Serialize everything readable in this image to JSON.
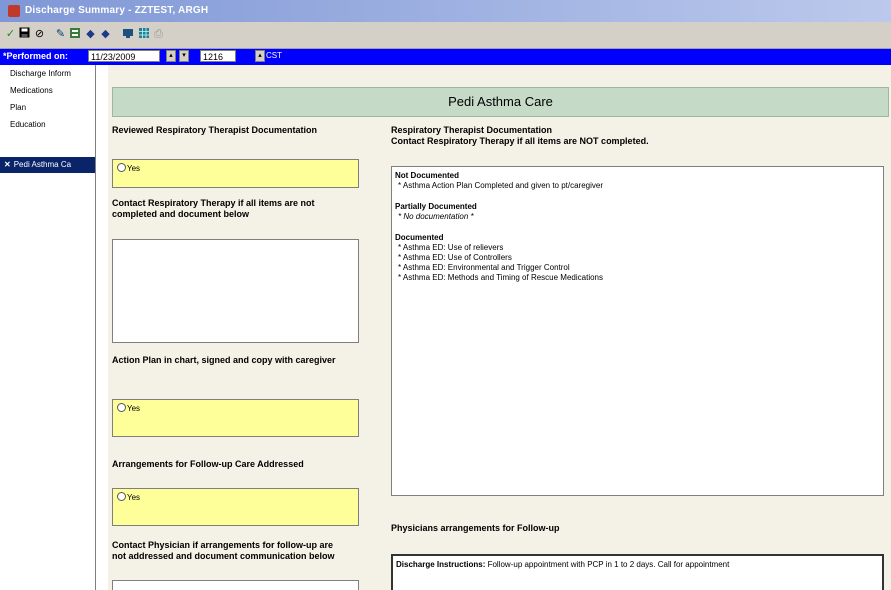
{
  "window": {
    "title": "Discharge Summary - ZZTEST, ARGH"
  },
  "toolbar": {
    "icons": [
      "checkmark-icon",
      "save-icon",
      "cancel-icon",
      "pen-icon",
      "form-icon",
      "arrow-left-icon",
      "arrow-right-icon",
      "monitor-icon",
      "grid-icon",
      "print-icon"
    ]
  },
  "performed": {
    "label": "*Performed on:",
    "date": "11/23/2009",
    "time": "1216",
    "timezone": "CST"
  },
  "sidebar": {
    "items": [
      {
        "label": "Discharge Inform"
      },
      {
        "label": "Medications"
      },
      {
        "label": "Plan"
      },
      {
        "label": "Education"
      },
      {
        "label": "Pedi Asthma Ca",
        "active_marker": "✕"
      }
    ]
  },
  "form": {
    "header": "Pedi Asthma Care",
    "reviewed_label": "Reviewed Respiratory Therapist Documentation",
    "yes_label": "Yes",
    "contact_rt_label": "Contact Respiratory Therapy if all items are not completed and document below",
    "action_plan_label": "Action Plan in chart, signed and copy with caregiver",
    "arrangements_label": "Arrangements for Follow-up Care Addressed",
    "contact_physician_label": "Contact Physician if arrangements for follow-up are not addressed and document communication below",
    "rt_doc_title_1": "Respiratory Therapist Documentation",
    "rt_doc_title_2": "Contact Respiratory Therapy if all items are NOT completed.",
    "rt_doc": {
      "not_documented_heading": "Not Documented",
      "not_documented": [
        "* Asthma Action Plan Completed and given to pt/caregiver"
      ],
      "partially_heading": "Partially Documented",
      "partially": [
        "* No documentation *"
      ],
      "documented_heading": "Documented",
      "documented": [
        "* Asthma ED: Use of relievers",
        "* Asthma ED: Use of Controllers",
        "* Asthma ED: Environmental and Trigger Control",
        "* Asthma ED: Methods and Timing of Rescue Medications"
      ]
    },
    "physician_arrangements_label": "Physicians arrangements for Follow-up",
    "discharge_instructions_label": "Discharge Instructions:",
    "discharge_instructions_text": " Follow-up appointment with PCP in 1 to 2 days.  Call for appointment"
  }
}
